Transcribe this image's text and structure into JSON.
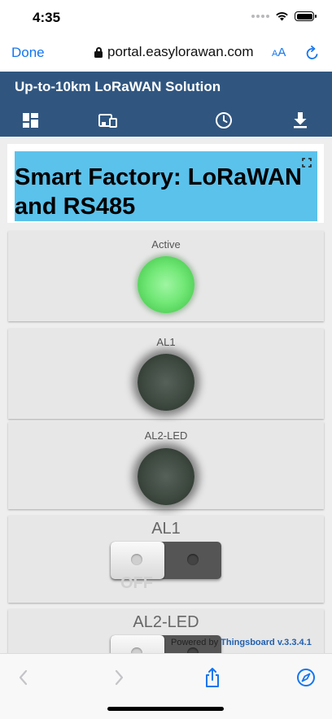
{
  "status_bar": {
    "time": "4:35"
  },
  "browser": {
    "done_label": "Done",
    "url": "portal.easylorawan.com",
    "aa_big": "A",
    "aa_small": "A"
  },
  "dashboard": {
    "header_title": "Up-to-10km LoRaWAN Solution",
    "title": "Smart Factory: LoRaWAN and RS485",
    "indicators": [
      {
        "label": "Active",
        "state": "on",
        "color": "#6ee672"
      },
      {
        "label": "AL1",
        "state": "off",
        "color": "#3b463d"
      },
      {
        "label": "AL2-LED",
        "state": "off",
        "color": "#3b463d"
      }
    ],
    "switches": [
      {
        "label": "AL1",
        "state_text": "OFF"
      },
      {
        "label": "AL2-LED",
        "state_text": ""
      }
    ],
    "footer": {
      "powered_by": "Powered by",
      "product": "Thingsboard v.3.3.4.1"
    }
  },
  "icons": {
    "header": [
      "dashboard-icon",
      "devices-icon",
      "clock-icon",
      "download-icon"
    ],
    "bottom": [
      "back-icon",
      "forward-icon",
      "share-icon",
      "compass-icon"
    ]
  },
  "colors": {
    "header_bg": "#305680",
    "title_bg": "#5bc2ec",
    "link_blue": "#1476f0"
  }
}
